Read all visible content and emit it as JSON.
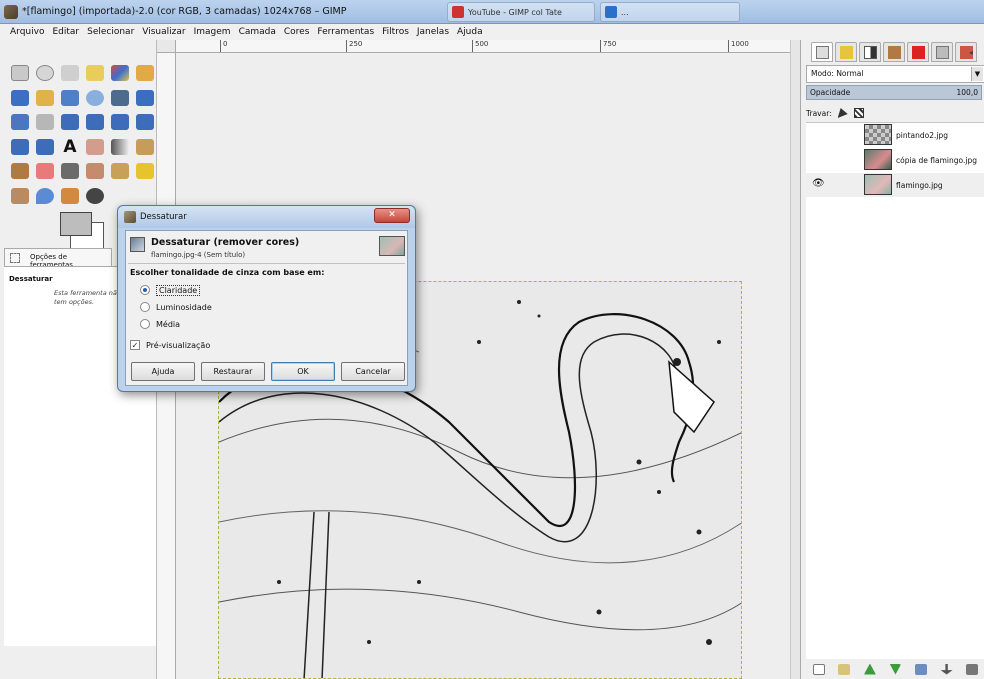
{
  "window": {
    "title": "*[flamingo] (importada)-2.0 (cor RGB, 3 camadas) 1024x768 – GIMP",
    "bg_tab_label": "YouTube - GIMP col Tate",
    "bg_tab2_label": "..."
  },
  "menu": [
    "Arquivo",
    "Editar",
    "Selecionar",
    "Visualizar",
    "Imagem",
    "Camada",
    "Cores",
    "Ferramentas",
    "Filtros",
    "Janelas",
    "Ajuda"
  ],
  "rulers": {
    "top": [
      "0",
      "250",
      "500",
      "750",
      "1000"
    ]
  },
  "toolbox": {
    "options_tab_label": "Opções de ferramentas",
    "tool_name": "Dessaturar",
    "tool_note": "Esta ferramenta não tem opções."
  },
  "dock": {
    "mode_label": "Modo: Normal",
    "opacity_label": "Opacidade",
    "opacity_value": "100,0",
    "lock_label": "Travar:",
    "menu_glyph": "◂",
    "layers": [
      {
        "name": "pintando2.jpg",
        "visible": false,
        "selected": false
      },
      {
        "name": "cópia de flamingo.jpg",
        "visible": false,
        "selected": false
      },
      {
        "name": "flamingo.jpg",
        "visible": true,
        "selected": true
      }
    ]
  },
  "dialog": {
    "title": "Dessaturar",
    "close_glyph": "✕",
    "heading": "Dessaturar (remover cores)",
    "subheading": "flamingo.jpg-4 (Sem título)",
    "question": "Escolher tonalidade de cinza com base em:",
    "options": [
      "Claridade",
      "Luminosidade",
      "Média"
    ],
    "selected_option": "Claridade",
    "preview_label": "Pré-visualização",
    "preview_checked": true,
    "buttons": {
      "help": "Ajuda",
      "reset": "Restaurar",
      "ok": "OK",
      "cancel": "Cancelar"
    }
  }
}
